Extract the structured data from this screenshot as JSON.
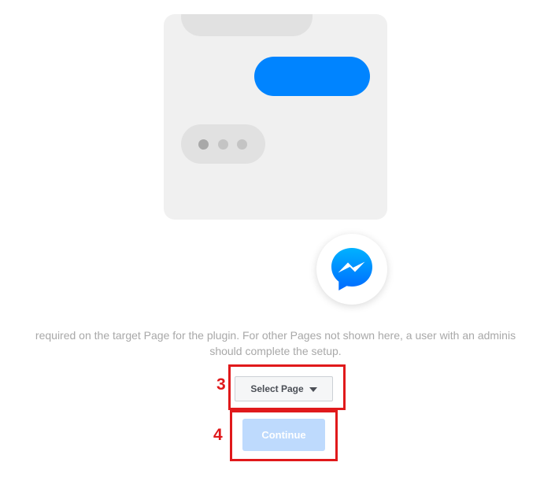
{
  "info_text": {
    "line1": "required on the target Page for the plugin. For other Pages not shown here, a user with an adminis",
    "line2": "should complete the setup."
  },
  "page_select": {
    "label": "Select Page"
  },
  "continue_button": {
    "label": "Continue"
  },
  "annotations": {
    "step3": "3",
    "step4": "4"
  },
  "colors": {
    "messenger_blue": "#0084ff",
    "annotation_red": "#e0191b",
    "continue_disabled": "#bedafd"
  },
  "icons": {
    "messenger": "messenger-logo-icon",
    "dropdown": "caret-down-icon"
  }
}
